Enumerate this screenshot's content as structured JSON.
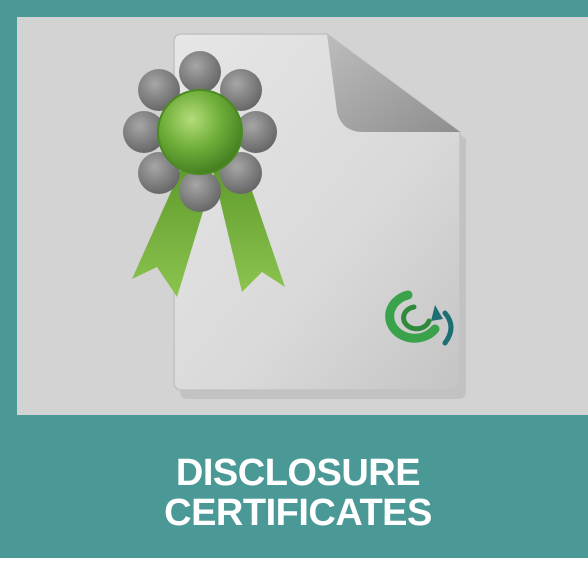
{
  "tile": {
    "label_line_1": "DISCLOSURE",
    "label_line_2": "CERTIFICATES",
    "icons": {
      "document": "document-icon",
      "award": "award-ribbon-icon",
      "logo": "brand-logo-icon"
    },
    "colors": {
      "frame": "#4b9996",
      "background": "#d3d3d3",
      "text": "#ffffff",
      "ribbon": "#7fb843",
      "seal": "#6fae3a",
      "petals": "#7a7a7a"
    }
  }
}
